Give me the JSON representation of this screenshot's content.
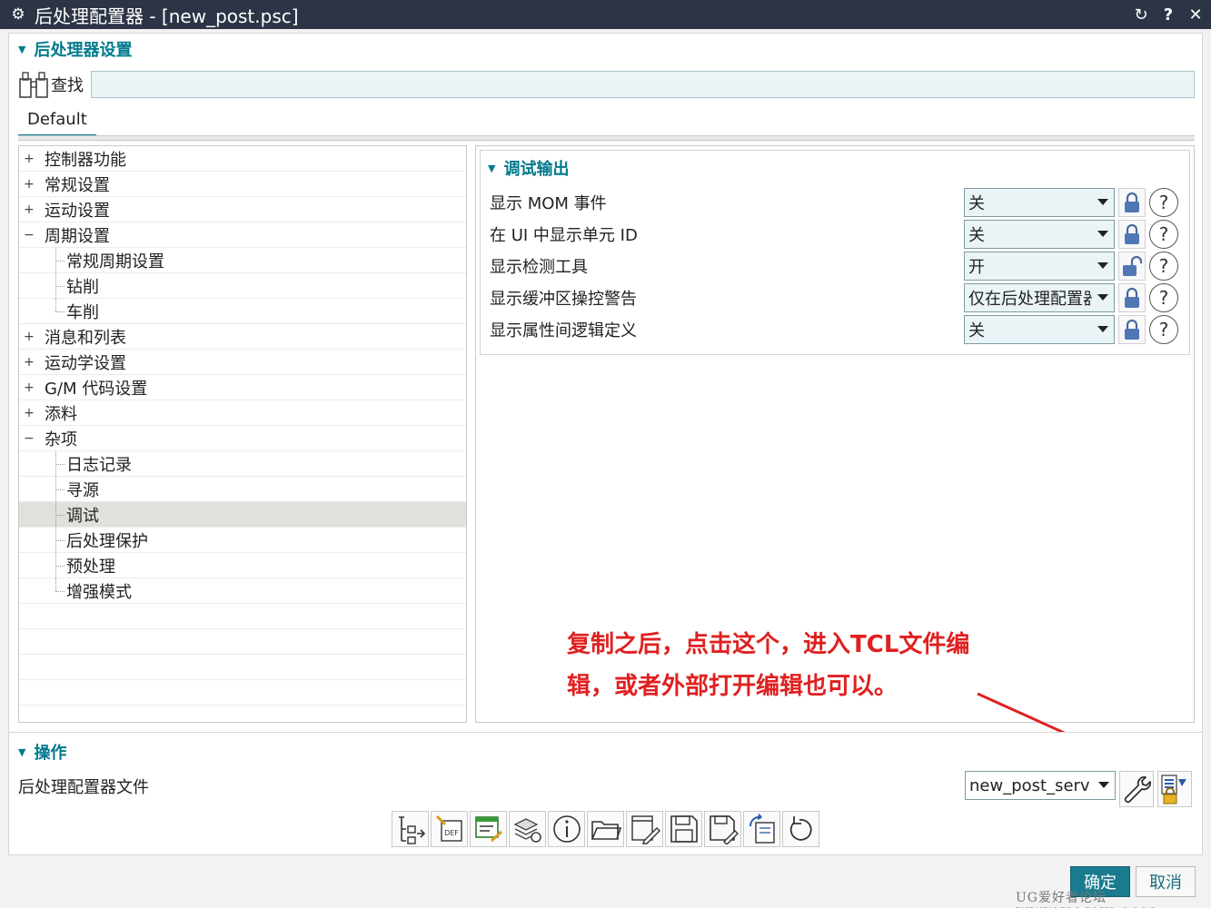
{
  "window": {
    "title": "后处理配置器 - [new_post.psc]"
  },
  "settings_section": {
    "title": "后处理器设置",
    "search_label": "查找",
    "search_value": "",
    "tab_label": "Default"
  },
  "tree": {
    "items": [
      {
        "label": "控制器功能",
        "expander": "+"
      },
      {
        "label": "常规设置",
        "expander": "+"
      },
      {
        "label": "运动设置",
        "expander": "+"
      },
      {
        "label": "周期设置",
        "expander": "−"
      },
      {
        "label": "常规周期设置",
        "expander": ""
      },
      {
        "label": "钻削",
        "expander": ""
      },
      {
        "label": "车削",
        "expander": ""
      },
      {
        "label": "消息和列表",
        "expander": "+"
      },
      {
        "label": "运动学设置",
        "expander": "+"
      },
      {
        "label": "G/M 代码设置",
        "expander": "+"
      },
      {
        "label": "添料",
        "expander": "+"
      },
      {
        "label": "杂项",
        "expander": "−"
      },
      {
        "label": "日志记录",
        "expander": ""
      },
      {
        "label": "寻源",
        "expander": ""
      },
      {
        "label": "调试",
        "expander": ""
      },
      {
        "label": "后处理保护",
        "expander": ""
      },
      {
        "label": "预处理",
        "expander": ""
      },
      {
        "label": "增强模式",
        "expander": ""
      }
    ]
  },
  "debug_output": {
    "title": "调试输出",
    "rows": [
      {
        "label": "显示 MOM 事件",
        "value": "关",
        "lock": "locked"
      },
      {
        "label": "在 UI 中显示单元 ID",
        "value": "关",
        "lock": "locked"
      },
      {
        "label": "显示检测工具",
        "value": "开",
        "lock": "unlocked"
      },
      {
        "label": "显示缓冲区操控警告",
        "value": "仅在后处理配置器",
        "lock": "locked"
      },
      {
        "label": "显示属性间逻辑定义",
        "value": "关",
        "lock": "locked"
      }
    ],
    "help_glyph": "?"
  },
  "annotation": {
    "line1": "复制之后，点击这个，进入TCL文件编",
    "line2": "辑，或者外部打开编辑也可以。",
    "color": "#e02020"
  },
  "operations": {
    "title": "操作",
    "file_label": "后处理配置器文件",
    "file_value": "new_post_service"
  },
  "buttons": {
    "ok": "确定",
    "cancel": "取消"
  },
  "watermark": "UG爱好者论坛 WWW.UGSNX.COM",
  "colors": {
    "titlebar": "#2c3446",
    "accent": "#007a8c",
    "ok_button": "#1a7b8e"
  }
}
